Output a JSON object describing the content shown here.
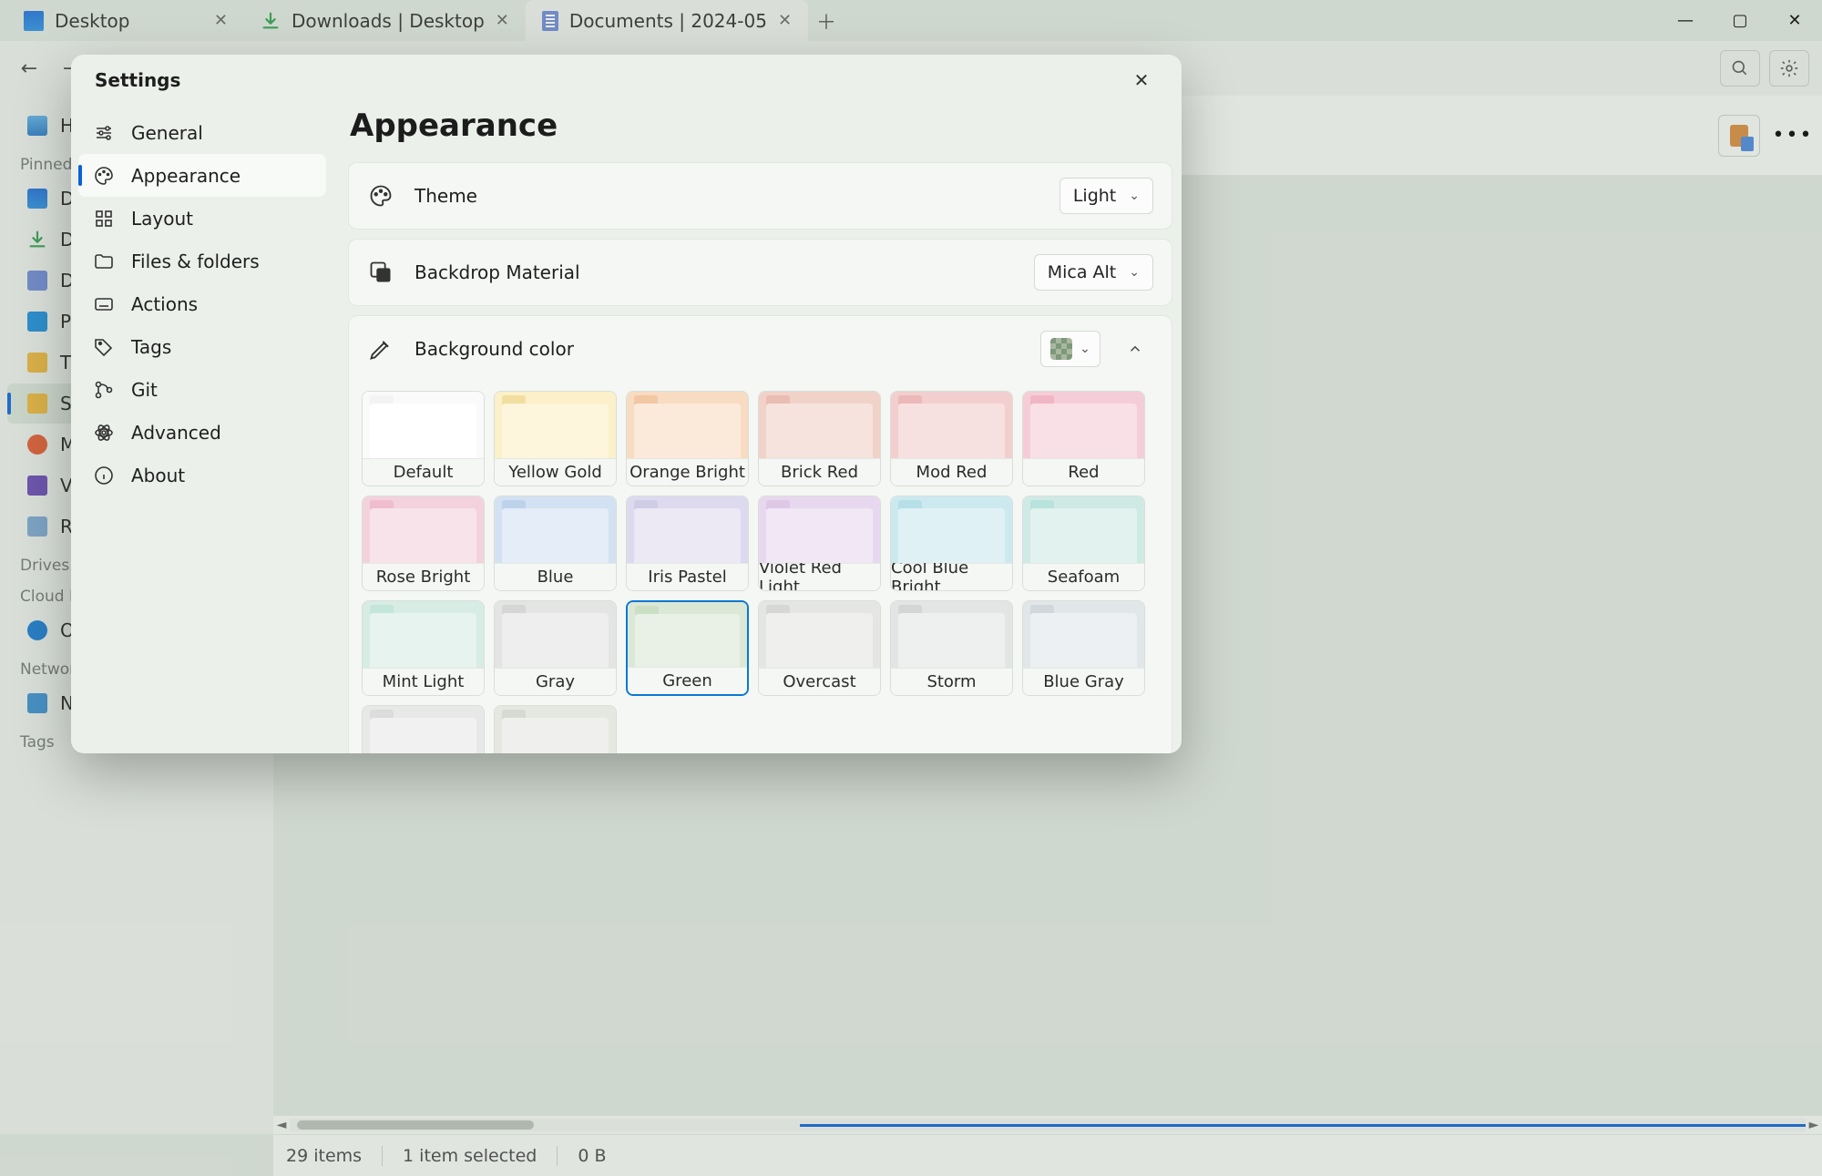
{
  "window": {
    "tabs": [
      {
        "label": "Desktop",
        "icon": "desktop"
      },
      {
        "label": "Downloads | Desktop",
        "icon": "download"
      },
      {
        "label": "Documents | 2024-05",
        "icon": "doc",
        "active": true
      }
    ],
    "controls": {
      "min": "—",
      "max": "▢",
      "close": "✕"
    }
  },
  "sidebar": {
    "home": "Home",
    "pinned_label": "Pinned",
    "pinned": [
      "Desktop",
      "Downloads",
      "Documents",
      "Pictures",
      "TGC",
      "Screenshots",
      "Music",
      "Videos",
      "Recycle Bin"
    ],
    "drives_label": "Drives",
    "cloud_label": "Cloud Drives",
    "cloud": [
      "OneDrive"
    ],
    "network_label": "Network Drives",
    "network": [
      "Network"
    ],
    "tags_label": "Tags"
  },
  "status": {
    "count": "29 items",
    "selected": "1 item selected",
    "size": "0 B"
  },
  "modal": {
    "title": "Settings",
    "nav": [
      {
        "label": "General",
        "icon": "sliders"
      },
      {
        "label": "Appearance",
        "icon": "palette",
        "selected": true
      },
      {
        "label": "Layout",
        "icon": "grid"
      },
      {
        "label": "Files & folders",
        "icon": "folder"
      },
      {
        "label": "Actions",
        "icon": "keyboard"
      },
      {
        "label": "Tags",
        "icon": "tag"
      },
      {
        "label": "Git",
        "icon": "git"
      },
      {
        "label": "Advanced",
        "icon": "atom"
      },
      {
        "label": "About",
        "icon": "info"
      }
    ],
    "pane": {
      "title": "Appearance",
      "theme": {
        "label": "Theme",
        "value": "Light"
      },
      "backdrop": {
        "label": "Backdrop Material",
        "value": "Mica Alt"
      },
      "bgcolor": {
        "label": "Background color"
      },
      "swatches": [
        {
          "name": "Default",
          "tab": "#f3f3f3",
          "body": "#ffffff",
          "bg": "#fafafa"
        },
        {
          "name": "Yellow Gold",
          "tab": "#f2de9f",
          "body": "#fdf5dc",
          "bg": "#fbf0c9"
        },
        {
          "name": "Orange Bright",
          "tab": "#f2c7a3",
          "body": "#fbe9da",
          "bg": "#f8dcc2"
        },
        {
          "name": "Brick Red",
          "tab": "#e9bdb3",
          "body": "#f6e3de",
          "bg": "#f1d2c9"
        },
        {
          "name": "Mod Red",
          "tab": "#ecb9b8",
          "body": "#f7e1e0",
          "bg": "#f2cfce"
        },
        {
          "name": "Red",
          "tab": "#f1b6c5",
          "body": "#f9e0e6",
          "bg": "#f5cdd8"
        },
        {
          "name": "Rose Bright",
          "tab": "#efbdcd",
          "body": "#f8e3ea",
          "bg": "#f3d2de"
        },
        {
          "name": "Blue",
          "tab": "#bdd3ec",
          "body": "#e4edf8",
          "bg": "#d3e2f2"
        },
        {
          "name": "Iris Pastel",
          "tab": "#cfcce6",
          "body": "#ece9f5",
          "bg": "#ddd9ee"
        },
        {
          "name": "Violet Red Light",
          "tab": "#ddc8e6",
          "body": "#f1e7f5",
          "bg": "#e8d8ef"
        },
        {
          "name": "Cool Blue Bright",
          "tab": "#b7dfe8",
          "body": "#e0f1f5",
          "bg": "#cde9f0"
        },
        {
          "name": "Seafoam",
          "tab": "#b8e2dc",
          "body": "#e1f2ef",
          "bg": "#cfeae5"
        },
        {
          "name": "Mint Light",
          "tab": "#c4e5da",
          "body": "#e6f3ee",
          "bg": "#d6ece4"
        },
        {
          "name": "Gray",
          "tab": "#d5d6d5",
          "body": "#eeeeee",
          "bg": "#e3e4e3"
        },
        {
          "name": "Green",
          "tab": "#cadfc4",
          "body": "#e9f0e6",
          "bg": "#dbe8d6",
          "selected": true
        },
        {
          "name": "Overcast",
          "tab": "#d7d8d6",
          "body": "#efefee",
          "bg": "#e5e6e4"
        },
        {
          "name": "Storm",
          "tab": "#d4d6d6",
          "body": "#eeefef",
          "bg": "#e3e5e5"
        },
        {
          "name": "Blue Gray",
          "tab": "#d2d7db",
          "body": "#edf0f2",
          "bg": "#e1e6e9"
        },
        {
          "name": "",
          "tab": "#dcdcdc",
          "body": "#f1f1f1",
          "bg": "#e8e8e8"
        },
        {
          "name": "",
          "tab": "#d7d9d3",
          "body": "#eff0ed",
          "bg": "#e5e7e1"
        }
      ]
    }
  }
}
